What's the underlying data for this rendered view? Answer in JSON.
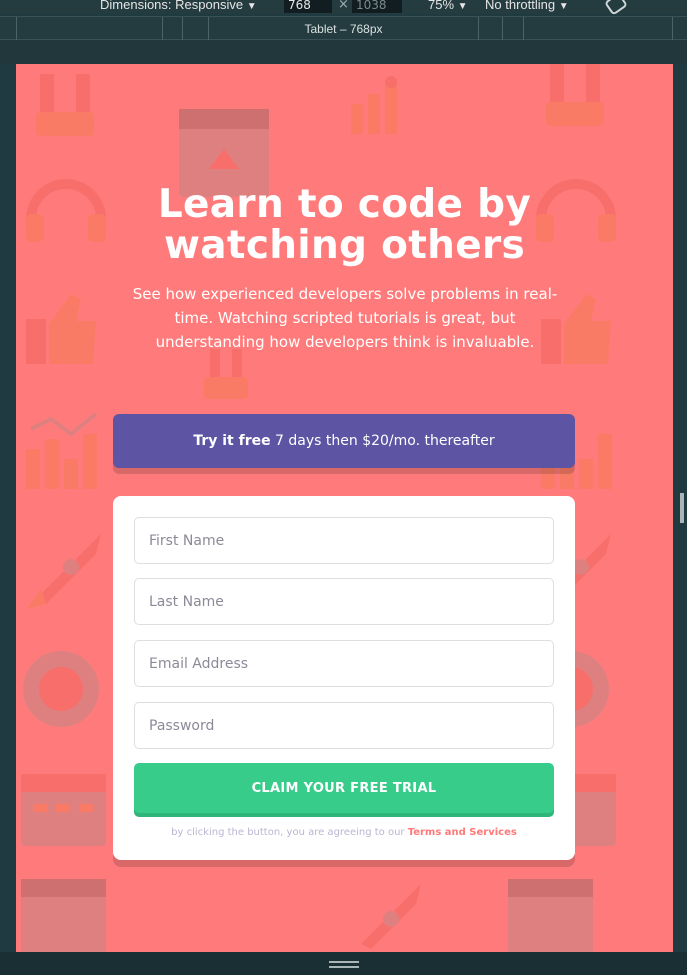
{
  "devtools": {
    "dimensions_label": "Dimensions: Responsive",
    "width_value": "768",
    "times": "×",
    "height_value": "1038",
    "zoom": "75%",
    "throttling": "No throttling",
    "breakpoint_label": "Tablet – 768px",
    "caret": "▼"
  },
  "hero": {
    "title_line1": "Learn to code by",
    "title_line2": "watching others",
    "text": "See how experienced developers solve problems in real-time. Watching scripted tutorials is great, but understanding how developers think is invaluable."
  },
  "promo": {
    "bold": "Try it free",
    "rest": " 7 days then $20/mo. thereafter"
  },
  "form": {
    "first_name_placeholder": "First Name",
    "last_name_placeholder": "Last Name",
    "email_placeholder": "Email Address",
    "password_placeholder": "Password",
    "submit_label": "CLAIM YOUR FREE TRIAL",
    "terms_prefix": "by clicking the button, you are agreeing to our ",
    "terms_link": "Terms and Services"
  },
  "colors": {
    "background": "#ff7b7b",
    "promo": "#5e54a4",
    "cta": "#38cc8b",
    "link": "#ff7979"
  }
}
